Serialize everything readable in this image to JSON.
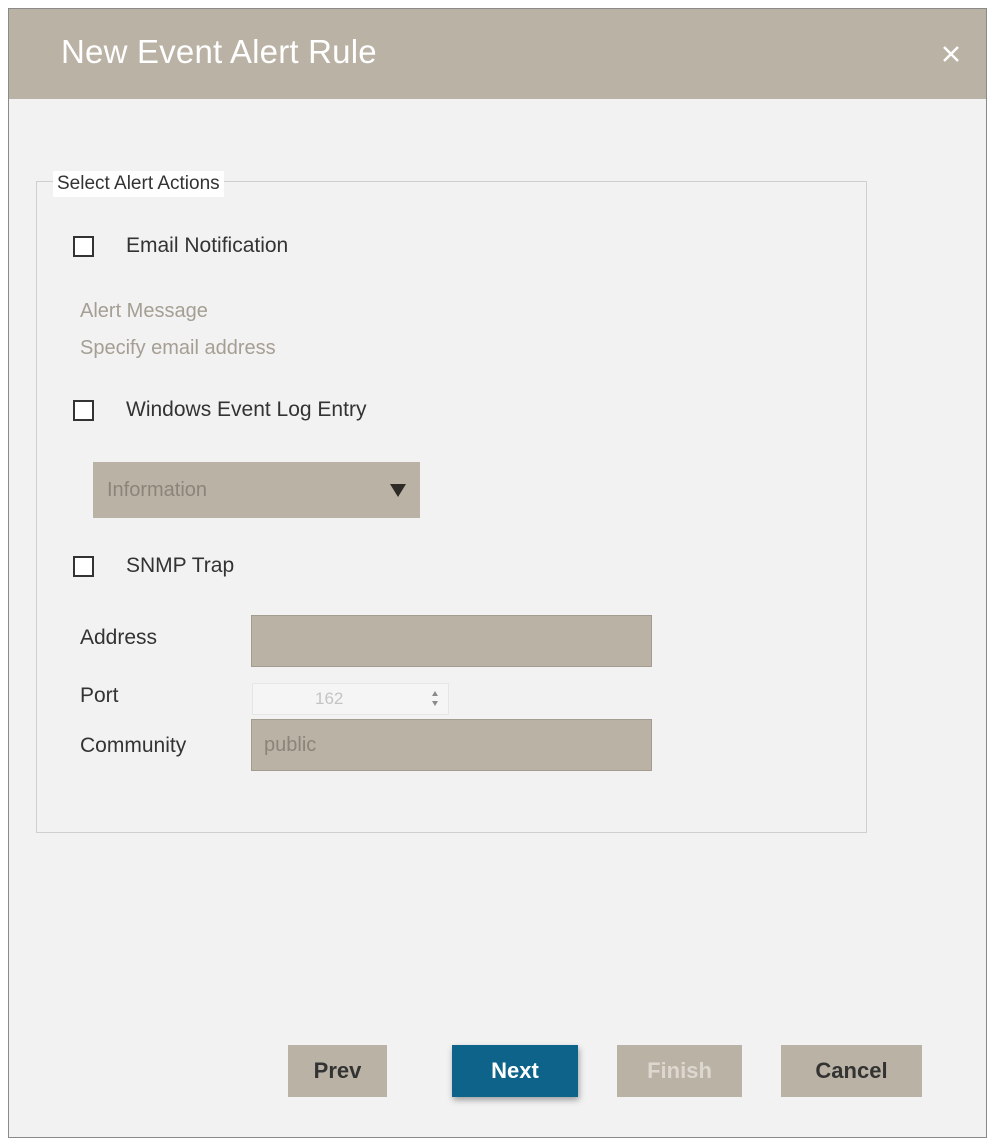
{
  "dialog": {
    "title": "New Event Alert Rule",
    "close_icon": "close-icon"
  },
  "section": {
    "legend": "Select Alert Actions"
  },
  "email": {
    "label": "Email Notification",
    "checked": false,
    "alert_message_text": "Alert Message",
    "address_prompt": "Specify email address"
  },
  "event_log": {
    "label": "Windows Event Log Entry",
    "checked": false,
    "level_value": "Information",
    "dropdown_icon": "dropdown-arrow-icon"
  },
  "snmp": {
    "label": "SNMP Trap",
    "checked": false,
    "address_label": "Address",
    "address_value": "",
    "port_label": "Port",
    "port_value": "162",
    "community_label": "Community",
    "community_value": "public"
  },
  "buttons": {
    "prev": "Prev",
    "next": "Next",
    "finish": "Finish",
    "cancel": "Cancel"
  },
  "colors": {
    "header": "#bab2a5",
    "primary_button": "#0d6389",
    "background": "#f2f2f2"
  }
}
